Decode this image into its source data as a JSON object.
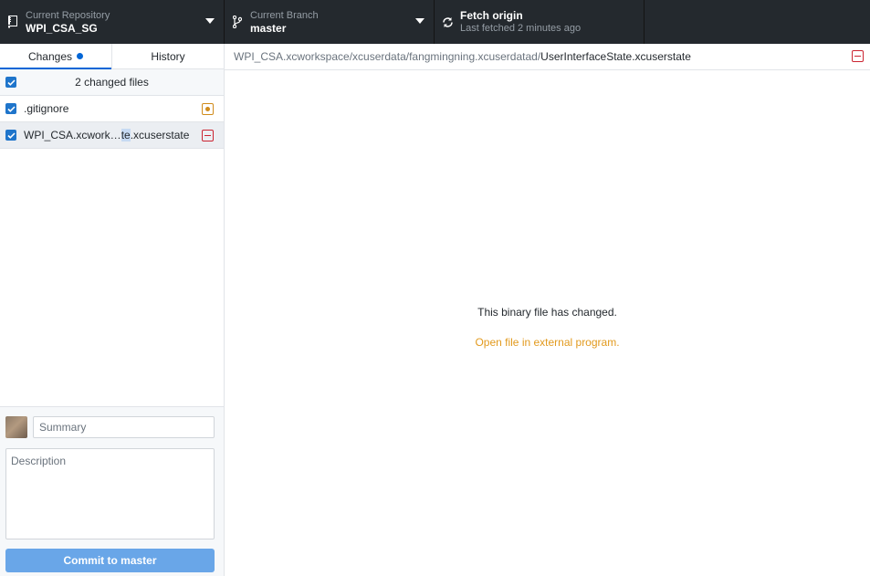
{
  "toolbar": {
    "repo": {
      "caption": "Current Repository",
      "name": "WPI_CSA_SG",
      "icon": "repo-icon"
    },
    "branch": {
      "caption": "Current Branch",
      "name": "master",
      "icon": "git-branch-icon"
    },
    "fetch": {
      "title": "Fetch origin",
      "subtitle": "Last fetched 2 minutes ago",
      "icon": "sync-icon"
    }
  },
  "sidebar": {
    "tabs": [
      {
        "label": "Changes",
        "active": true,
        "has_dot": true
      },
      {
        "label": "History",
        "active": false
      }
    ],
    "changes_header": "2 changed files",
    "files": [
      {
        "name": "\u0000.gitignore",
        "status": "modified"
      },
      {
        "name_pre": "WPI_CSA.xcwork…",
        "name_hl": "te",
        "name_post": ".xcuserstate",
        "status": "deleted"
      }
    ]
  },
  "commit": {
    "summary_placeholder": "Summary",
    "description_placeholder": "Description",
    "button_label": "Commit to master"
  },
  "diff": {
    "path_dir": "WPI_CSA.xcworkspace/xcuserdata/fangmingning.xcuserdatad/",
    "path_file": "UserInterfaceState.xcuserstate",
    "binary_message": "This binary file has changed.",
    "open_link": "Open file in external program."
  },
  "colors": {
    "toolbar_bg": "#24292e",
    "accent": "#0366d6",
    "modified": "#d08b1b",
    "deleted": "#cb2431",
    "link": "#e29a1e"
  }
}
